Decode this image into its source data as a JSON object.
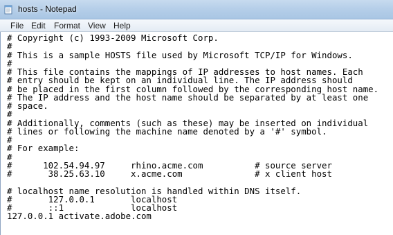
{
  "window": {
    "title": "hosts - Notepad"
  },
  "icons": {
    "app": "notepad-icon"
  },
  "menu": {
    "file": "File",
    "edit": "Edit",
    "format": "Format",
    "view": "View",
    "help": "Help"
  },
  "document": {
    "text": "# Copyright (c) 1993-2009 Microsoft Corp.\n#\n# This is a sample HOSTS file used by Microsoft TCP/IP for Windows.\n#\n# This file contains the mappings of IP addresses to host names. Each\n# entry should be kept on an individual line. The IP address should\n# be placed in the first column followed by the corresponding host name.\n# The IP address and the host name should be separated by at least one\n# space.\n#\n# Additionally, comments (such as these) may be inserted on individual\n# lines or following the machine name denoted by a '#' symbol.\n#\n# For example:\n#\n#      102.54.94.97     rhino.acme.com          # source server\n#       38.25.63.10     x.acme.com              # x client host\n\n# localhost name resolution is handled within DNS itself.\n#\t127.0.0.1       localhost\n#\t::1             localhost\n127.0.0.1 activate.adobe.com"
  }
}
